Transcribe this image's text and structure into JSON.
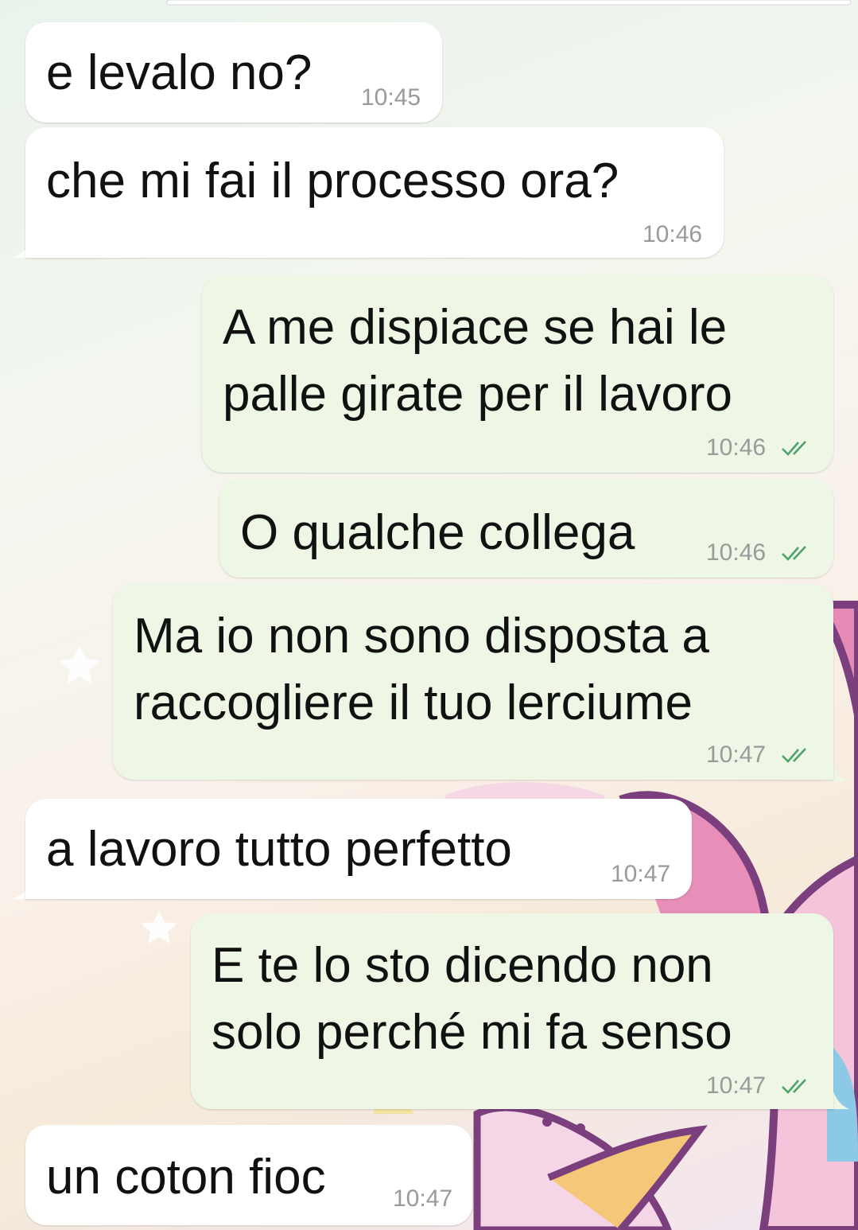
{
  "messages": [
    {
      "id": "m1",
      "dir": "in",
      "lines": [
        "e levalo no?"
      ],
      "time": "10:45"
    },
    {
      "id": "m2",
      "dir": "in",
      "lines": [
        "che mi fai il processo ora?"
      ],
      "time": "10:46"
    },
    {
      "id": "m3",
      "dir": "out",
      "lines": [
        "A me dispiace se hai le",
        "palle girate per il lavoro"
      ],
      "time": "10:46",
      "status": "read"
    },
    {
      "id": "m4",
      "dir": "out",
      "lines": [
        "O qualche collega"
      ],
      "time": "10:46",
      "status": "read"
    },
    {
      "id": "m5",
      "dir": "out",
      "lines": [
        "Ma io non sono disposta a",
        "raccogliere il tuo lerciume"
      ],
      "time": "10:47",
      "status": "read"
    },
    {
      "id": "m6",
      "dir": "in",
      "lines": [
        "a lavoro tutto perfetto"
      ],
      "time": "10:47"
    },
    {
      "id": "m7",
      "dir": "out",
      "lines": [
        "E te lo sto dicendo non",
        "solo perché mi fa senso"
      ],
      "time": "10:47",
      "status": "read"
    },
    {
      "id": "m8",
      "dir": "in",
      "lines": [
        "un coton fioc"
      ],
      "time": "10:47"
    }
  ],
  "icons": {
    "read_status": "double-check-icon"
  },
  "colors": {
    "incoming_bubble": "#ffffff",
    "outgoing_bubble": "#eef7e6",
    "read_ticks": "#4fa36a",
    "time_text": "#9a9a9a"
  }
}
